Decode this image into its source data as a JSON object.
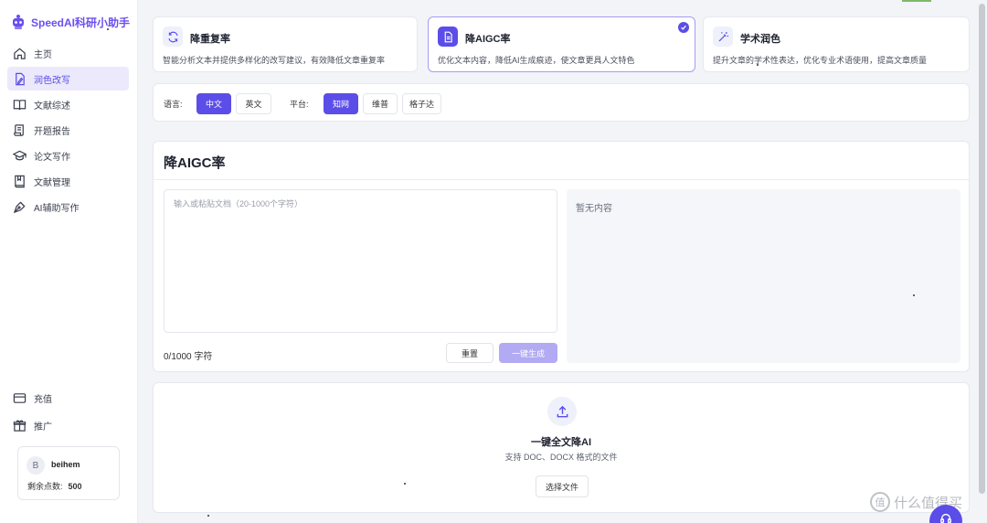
{
  "brand": {
    "name": "SpeedAI科研小助手",
    "accent": "#5b4de8"
  },
  "nav": {
    "items": [
      {
        "label": "主页",
        "icon": "home-icon"
      },
      {
        "label": "润色改写",
        "icon": "edit-document-icon",
        "active": true
      },
      {
        "label": "文献综述",
        "icon": "open-book-icon"
      },
      {
        "label": "开题报告",
        "icon": "scroll-icon"
      },
      {
        "label": "论文写作",
        "icon": "graduation-cap-icon"
      },
      {
        "label": "文献管理",
        "icon": "bookmark-book-icon"
      },
      {
        "label": "AI辅助写作",
        "icon": "pen-nib-icon"
      }
    ],
    "bottom": [
      {
        "label": "充值",
        "icon": "credit-card-icon"
      },
      {
        "label": "推广",
        "icon": "gift-icon"
      }
    ]
  },
  "user": {
    "avatar_letter": "B",
    "name": "beihem",
    "points_label": "剩余点数:",
    "points": "500"
  },
  "modes": [
    {
      "title": "降重复率",
      "desc": "智能分析文本并提供多样化的改写建议，有效降低文章重复率",
      "icon": "refresh-icon"
    },
    {
      "title": "降AIGC率",
      "desc": "优化文本内容，降低AI生成痕迹，使文章更具人文特色",
      "icon": "document-icon",
      "selected": true
    },
    {
      "title": "学术润色",
      "desc": "提升文章的学术性表达，优化专业术语使用，提高文章质量",
      "icon": "magic-wand-icon"
    }
  ],
  "options": {
    "language_label": "语言:",
    "languages": [
      "中文",
      "英文"
    ],
    "language_selected": "中文",
    "platform_label": "平台:",
    "platforms": [
      "知网",
      "维普",
      "格子达"
    ],
    "platform_selected": "知网"
  },
  "editor": {
    "title": "降AIGC率",
    "placeholder": "输入或粘贴文档（20-1000个字符）",
    "value": "",
    "char_count": "0/1000 字符",
    "reset_label": "重置",
    "generate_label": "一键生成",
    "output_empty": "暂无内容"
  },
  "upload": {
    "title": "一键全文降AI",
    "subtitle": "支持 DOC、DOCX 格式的文件",
    "button": "选择文件"
  },
  "watermark": {
    "text": "什么值得买",
    "mark": "值"
  }
}
